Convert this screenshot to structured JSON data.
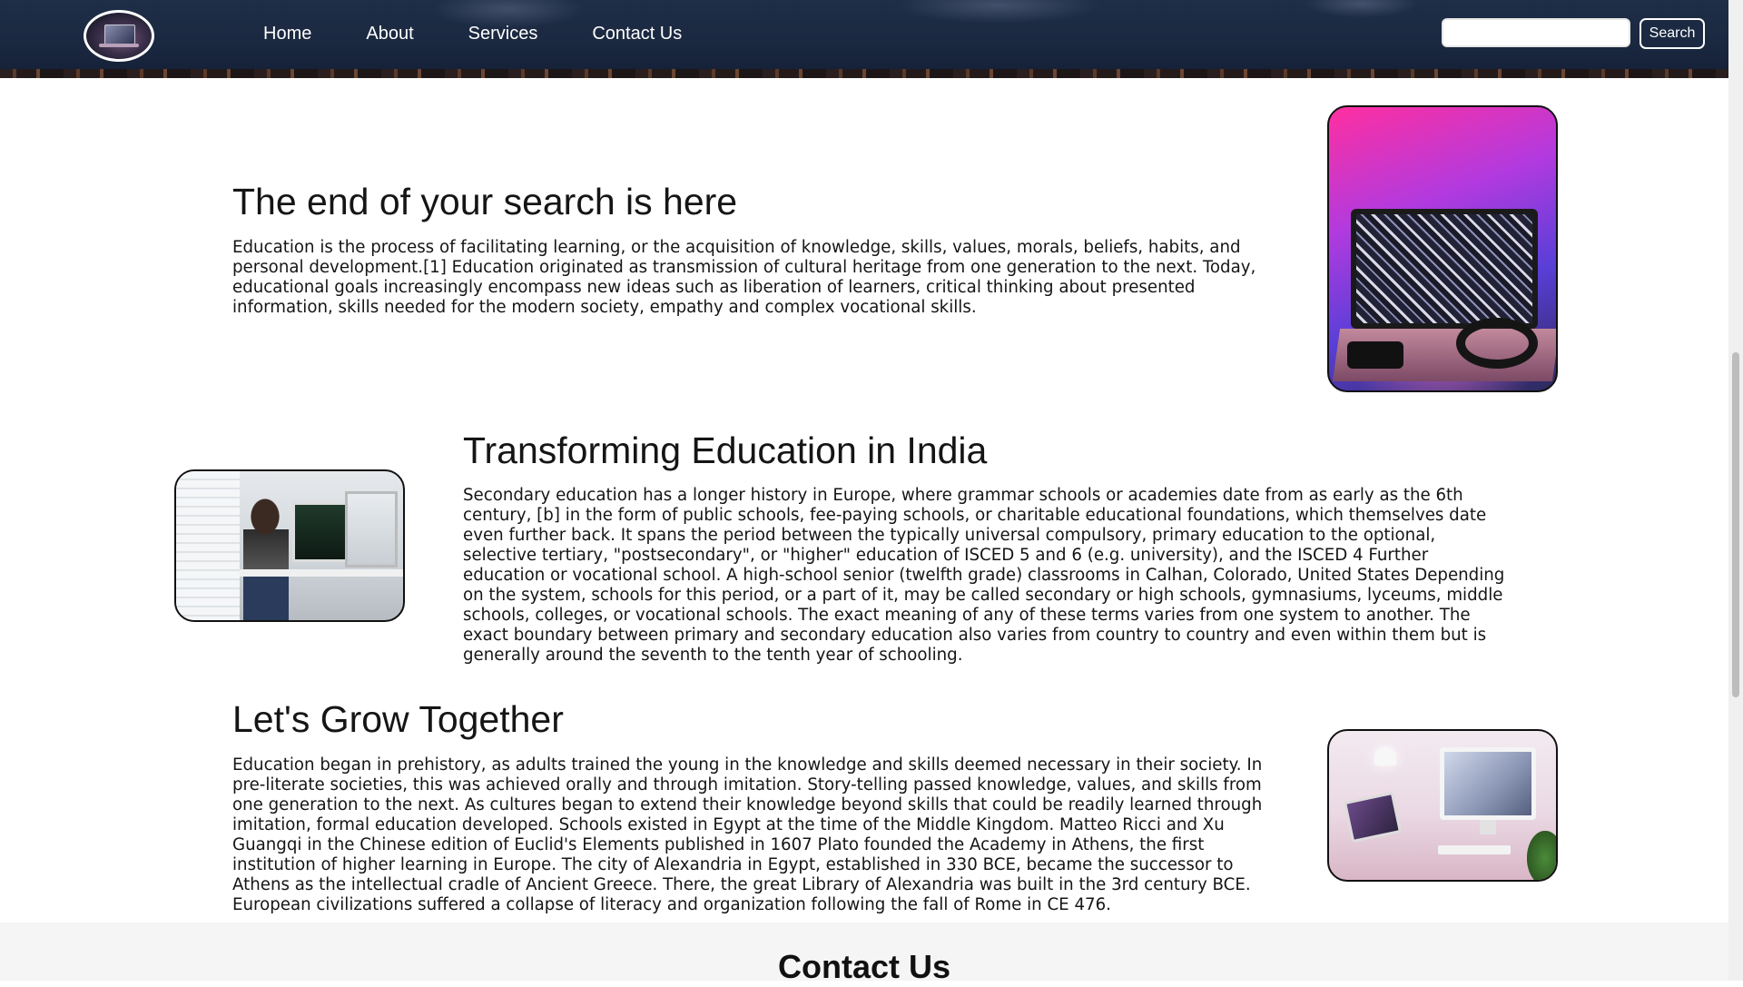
{
  "nav": {
    "links": [
      "Home",
      "About",
      "Services",
      "Contact Us"
    ],
    "search_placeholder": "",
    "search_button": "Search"
  },
  "sections": [
    {
      "title": "The end of your search is here",
      "text": "Education is the process of facilitating learning, or the acquisition of knowledge, skills, values, morals, beliefs, habits, and personal development.[1] Education originated as transmission of cultural heritage from one generation to the next. Today, educational goals increasingly encompass new ideas such as liberation of learners, critical thinking about presented information, skills needed for the modern society, empathy and complex vocational skills."
    },
    {
      "title": "Transforming Education in India",
      "text": "Secondary education has a longer history in Europe, where grammar schools or academies date from as early as the 6th century, [b] in the form of public schools, fee-paying schools, or charitable educational foundations, which themselves date even further back. It spans the period between the typically universal compulsory, primary education to the optional, selective tertiary, \"postsecondary\", or \"higher\" education of ISCED 5 and 6 (e.g. university), and the ISCED 4 Further education or vocational school. A high-school senior (twelfth grade) classrooms in Calhan, Colorado, United States Depending on the system, schools for this period, or a part of it, may be called secondary or high schools, gymnasiums, lyceums, middle schools, colleges, or vocational schools. The exact meaning of any of these terms varies from one system to another. The exact boundary between primary and secondary education also varies from country to country and even within them but is generally around the seventh to the tenth year of schooling."
    },
    {
      "title": "Let's Grow Together",
      "text": "Education began in prehistory, as adults trained the young in the knowledge and skills deemed necessary in their society. In pre-literate societies, this was achieved orally and through imitation. Story-telling passed knowledge, values, and skills from one generation to the next. As cultures began to extend their knowledge beyond skills that could be readily learned through imitation, formal education developed. Schools existed in Egypt at the time of the Middle Kingdom. Matteo Ricci and Xu Guangqi in the Chinese edition of Euclid's Elements published in 1607 Plato founded the Academy in Athens, the first institution of higher learning in Europe. The city of Alexandria in Egypt, established in 330 BCE, became the successor to Athens as the intellectual cradle of Ancient Greece. There, the great Library of Alexandria was built in the 3rd century BCE. European civilizations suffered a collapse of literacy and organization following the fall of Rome in CE 476."
    }
  ],
  "contact": {
    "title": "Contact Us"
  },
  "icons": {
    "logo": "laptop-logo-icon"
  },
  "colors": {
    "nav_background": "#1a2840",
    "nav_text": "#ffffff",
    "page_background": "#ffffff",
    "contact_background": "#f5f5f5"
  }
}
